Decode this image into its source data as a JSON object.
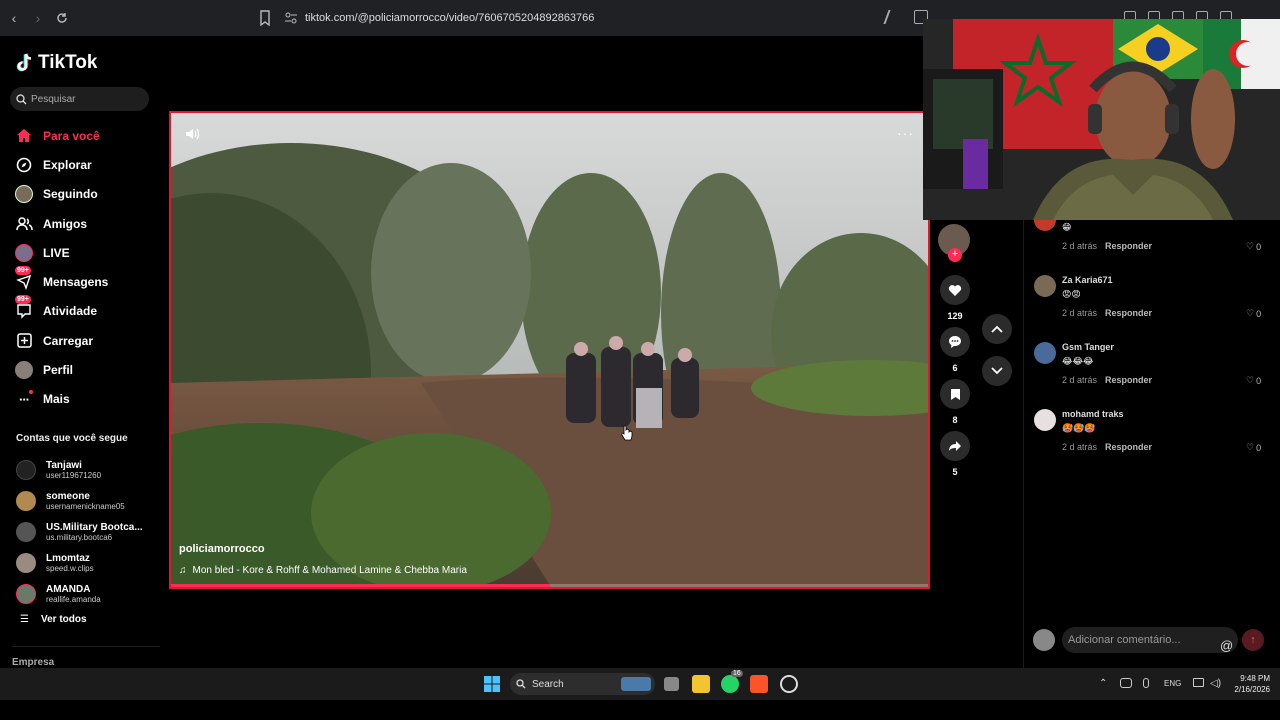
{
  "browser": {
    "url": "tiktok.com/@policiamorrocco/video/7606705204892863766"
  },
  "sidebar": {
    "logo": "TikTok",
    "search_placeholder": "Pesquisar",
    "nav": [
      {
        "label": "Para você",
        "icon": "home-icon",
        "active": true
      },
      {
        "label": "Explorar",
        "icon": "compass-icon"
      },
      {
        "label": "Seguindo",
        "icon": "following-avatar-icon"
      },
      {
        "label": "Amigos",
        "icon": "friends-icon"
      },
      {
        "label": "LIVE",
        "icon": "live-icon"
      },
      {
        "label": "Mensagens",
        "icon": "messages-icon",
        "badge": "99+"
      },
      {
        "label": "Atividade",
        "icon": "activity-icon",
        "badge": "99+"
      },
      {
        "label": "Carregar",
        "icon": "upload-icon"
      },
      {
        "label": "Perfil",
        "icon": "profile-avatar-icon"
      },
      {
        "label": "Mais",
        "icon": "more-dots-icon"
      }
    ],
    "following_title": "Contas que você segue",
    "following": [
      {
        "name": "Tanjawi",
        "user": "user119671260"
      },
      {
        "name": "someone",
        "user": "usernamenickname05"
      },
      {
        "name": "US.Military Bootca...",
        "user": "us.military.bootca6"
      },
      {
        "name": "Lmomtaz",
        "user": "speed.w.clips"
      },
      {
        "name": "AMANDA",
        "user": "reallife.amanda"
      }
    ],
    "see_all": "Ver todos",
    "company": "Empresa"
  },
  "video": {
    "author": "policiamorrocco",
    "music": "Mon bled - Kore & Rohff & Mohamed Lamine & Chebba Maria",
    "progress": 0.5
  },
  "actions": {
    "likes": "129",
    "comments": "6",
    "saves": "8",
    "shares": "5"
  },
  "comments": [
    {
      "name": "",
      "text": "😁",
      "time": "2 d atrás",
      "reply": "Responder",
      "likes": "0"
    },
    {
      "name": "Za Karia671",
      "text": "😡😡",
      "time": "2 d atrás",
      "reply": "Responder",
      "likes": "0"
    },
    {
      "name": "Gsm Tanger",
      "text": "😂😂😂",
      "time": "2 d atrás",
      "reply": "Responder",
      "likes": "0"
    },
    {
      "name": "mohamd traks",
      "text": "🥵🥵🥵",
      "time": "2 d atrás",
      "reply": "Responder",
      "likes": "0"
    }
  ],
  "comment_input": {
    "placeholder": "Adicionar comentário..."
  },
  "taskbar": {
    "search": "Search",
    "lang": "ENG",
    "time": "9:48 PM",
    "date": "2/16/2026",
    "whatsapp_badge": "16"
  }
}
